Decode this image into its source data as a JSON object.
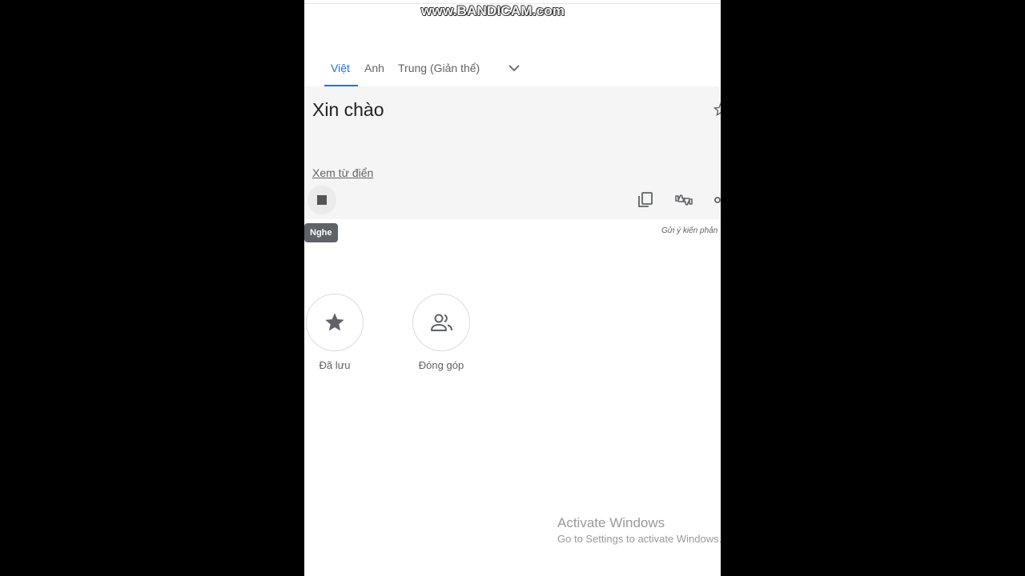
{
  "watermark": "www.BANDICAM.com",
  "tabs": [
    {
      "label": "Việt",
      "active": true
    },
    {
      "label": "Anh",
      "active": false
    },
    {
      "label": "Trung (Giản thể)",
      "active": false
    }
  ],
  "result": {
    "text": "Xin chào",
    "dictionary_link": "Xem từ điển"
  },
  "tooltip": "Nghe",
  "feedback": "Gửi ý kiến phản",
  "shortcuts": [
    {
      "label": "Đã lưu",
      "icon": "star-icon"
    },
    {
      "label": "Đóng góp",
      "icon": "people-icon"
    }
  ],
  "activation": {
    "title": "Activate Windows",
    "subtitle": "Go to Settings to activate Windows."
  },
  "colors": {
    "accent": "#1a73e8",
    "result_bg": "#f5f5f5",
    "tooltip_bg": "#5f6368"
  }
}
